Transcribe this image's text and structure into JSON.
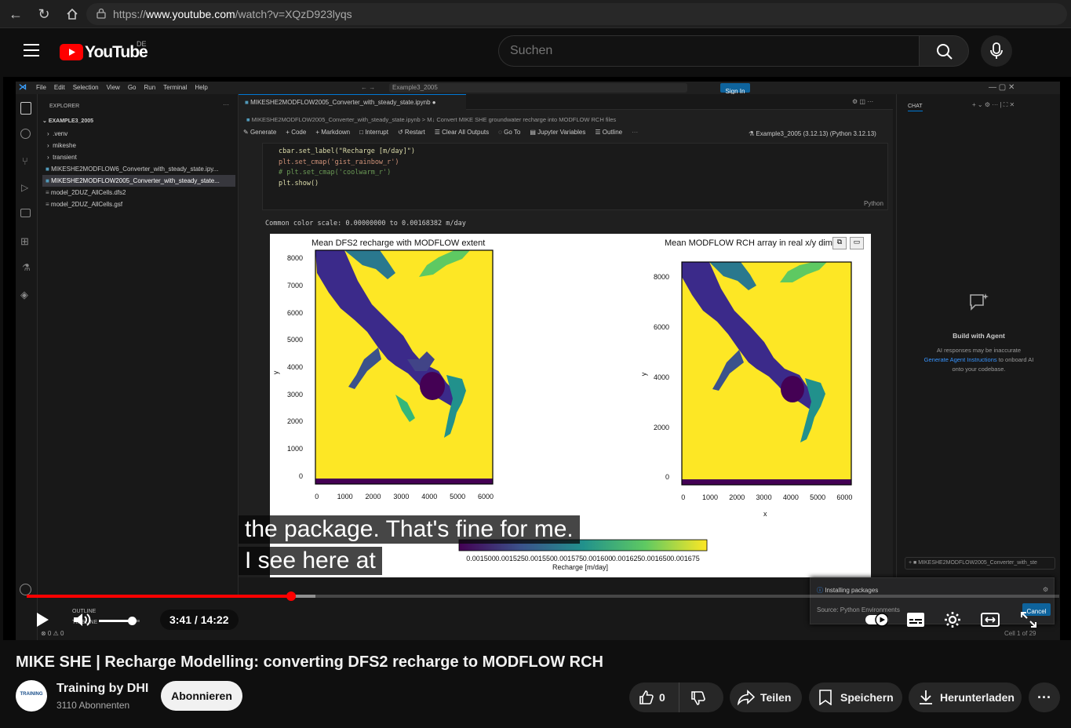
{
  "browser": {
    "url_prefix": "https://",
    "url_host": "www.youtube.com",
    "url_path": "/watch?v=XQzD923lyqs"
  },
  "youtube": {
    "logo_text": "YouTube",
    "region": "DE",
    "search_placeholder": "Suchen"
  },
  "vscode": {
    "menu": [
      "File",
      "Edit",
      "Selection",
      "View",
      "Go",
      "Run",
      "Terminal",
      "Help"
    ],
    "command_center": "Example3_2005",
    "sign_in": "Sign In",
    "explorer_title": "EXPLORER",
    "workspace": "EXAMPLE3_2005",
    "tree": [
      {
        "label": ".venv",
        "kind": "folder"
      },
      {
        "label": "mikeshe",
        "kind": "folder"
      },
      {
        "label": "transient",
        "kind": "folder"
      },
      {
        "label": "MIKESHE2MODFLOW6_Converter_with_steady_state.ipy...",
        "kind": "notebook"
      },
      {
        "label": "MIKESHE2MODFLOW2005_Converter_with_steady_state...",
        "kind": "notebook"
      },
      {
        "label": "model_2DUZ_AllCells.dfs2",
        "kind": "file"
      },
      {
        "label": "model_2DUZ_AllCells.gsf",
        "kind": "file"
      }
    ],
    "tab": "MIKESHE2MODFLOW2005_Converter_with_steady_state.ipynb",
    "breadcrumb": "MIKESHE2MODFLOW2005_Converter_with_steady_state.ipynb > M↓ Convert MIKE SHE groundwater recharge into MODFLOW RCH files",
    "toolbar": [
      "Generate",
      "+ Code",
      "+ Markdown",
      "Interrupt",
      "Restart",
      "Clear All Outputs",
      "Go To",
      "Jupyter Variables",
      "Outline"
    ],
    "kernel": "Example3_2005 (3.12.13) (Python 3.12.13)",
    "code_lines": [
      "cbar.set_label(\"Recharge [m/day]\")",
      "plt.set_cmap('gist_rainbow_r')",
      "# plt.set_cmap('coolwarm_r')",
      "plt.show()"
    ],
    "cell_lang": "Python",
    "output_text": "Common color scale: 0.00000000 to 0.00168382 m/day",
    "chat_title": "CHAT",
    "chat_heading": "Build with Agent",
    "chat_line1": "AI responses may be inaccurate",
    "chat_link": "Generate Agent Instructions",
    "chat_line2a": "to onboard AI",
    "chat_line3": "onto your codebase.",
    "chat_context": "MIKESHE2MODFLOW2005_Converter_with_ste",
    "outline_label": "OUTLINE",
    "timeline_label": "TIMELINE",
    "status_problems": "⊗ 0 ⚠ 0",
    "status_cell": "Cell 1 of 29",
    "notif_title": "Installing packages",
    "notif_source": "Source: Python Environments",
    "notif_cancel": "Cancel"
  },
  "chart_data": [
    {
      "type": "heatmap",
      "title": "Mean DFS2 recharge with MODFLOW extent",
      "xlabel": "x",
      "ylabel": "y",
      "xticks": [
        0,
        1000,
        2000,
        3000,
        4000,
        5000,
        6000
      ],
      "yticks": [
        0,
        1000,
        2000,
        3000,
        4000,
        5000,
        6000,
        7000,
        8000
      ]
    },
    {
      "type": "heatmap",
      "title": "Mean MODFLOW RCH array in real x/y dim",
      "xlabel": "x",
      "ylabel": "y",
      "xticks": [
        0,
        1000,
        2000,
        3000,
        4000,
        5000,
        6000
      ],
      "yticks": [
        0,
        2000,
        4000,
        6000,
        8000
      ]
    },
    {
      "type": "colorbar",
      "label": "Recharge [m/day]",
      "ticks": [
        "0.001500",
        "0.001525",
        "0.001550",
        "0.001575",
        "0.001600",
        "0.001625",
        "0.001650",
        "0.001675"
      ]
    }
  ],
  "captions": [
    "the package. That's fine for me.",
    "I see here at"
  ],
  "player": {
    "time": "3:41 / 14:22",
    "progress": 0.256,
    "buffered": 0.28,
    "volume": 0.8
  },
  "video": {
    "title": "MIKE SHE | Recharge Modelling: converting DFS2 recharge to MODFLOW RCH",
    "channel": "Training by DHI",
    "subscribers": "3110 Abonnenten",
    "avatar_text": "TRAINING",
    "subscribe": "Abonnieren",
    "likes": "0",
    "share": "Teilen",
    "save": "Speichern",
    "download": "Herunterladen"
  },
  "colors": {
    "yt_red": "#ff0000",
    "progress_red": "#f00",
    "viridis_dark": "#440154",
    "viridis_mid": "#21918c",
    "viridis_yellow": "#fde725"
  }
}
